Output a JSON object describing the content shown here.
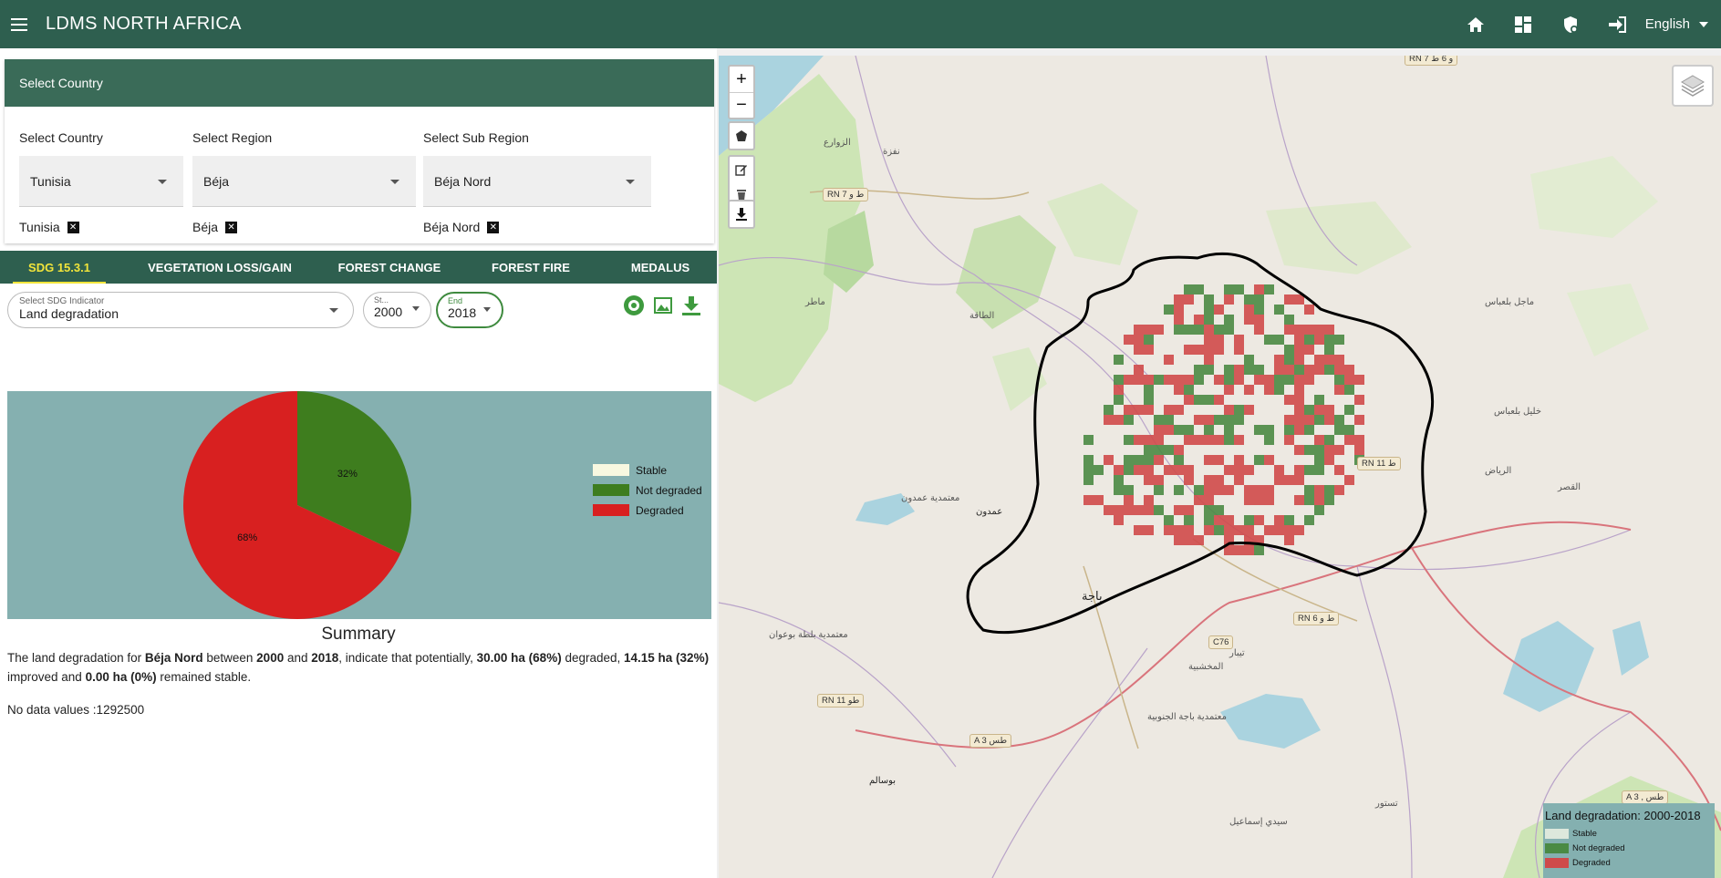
{
  "header": {
    "title": "LDMS NORTH AFRICA",
    "language": "English"
  },
  "country_card": {
    "title": "Select Country",
    "country_label": "Select Country",
    "region_label": "Select Region",
    "subregion_label": "Select Sub Region",
    "country_value": "Tunisia",
    "region_value": "Béja",
    "subregion_value": "Béja Nord",
    "chips": [
      "Tunisia",
      "Béja",
      "Béja Nord"
    ]
  },
  "tabs": [
    {
      "label": "SDG 15.3.1",
      "active": true
    },
    {
      "label": "VEGETATION LOSS/GAIN",
      "active": false
    },
    {
      "label": "FOREST CHANGE",
      "active": false
    },
    {
      "label": "FOREST FIRE",
      "active": false
    },
    {
      "label": "MEDALUS",
      "active": false
    }
  ],
  "controls": {
    "indicator_label": "Select SDG Indicator",
    "indicator_value": "Land degradation",
    "start_label": "St...",
    "start_value": "2000",
    "end_label": "End",
    "end_value": "2018"
  },
  "chart_data": {
    "type": "pie",
    "title": "",
    "categories": [
      "Stable",
      "Not degraded",
      "Degraded"
    ],
    "values": [
      0,
      32,
      68
    ],
    "labels": [
      "",
      "32%",
      "68%"
    ],
    "colors": [
      "#f8f8e0",
      "#3e7d1e",
      "#d82020"
    ],
    "legend": "right"
  },
  "summary": {
    "title": "Summary",
    "t1": "The land degradation for ",
    "region": "Béja Nord",
    "t2": " between ",
    "start": "2000",
    "t3": " and ",
    "end": "2018",
    "t4": ", indicate that potentially, ",
    "degraded": "30.00 ha (68%)",
    "t5": " degraded, ",
    "improved": "14.15 ha (32%)",
    "t6": " improved and ",
    "stable": "0.00 ha (0%)",
    "t7": " remained stable.",
    "nodata": "No data values :1292500"
  },
  "map": {
    "zoom_in": "+",
    "zoom_out": "−",
    "legend_title": "Land degradation: 2000-2018",
    "legend": [
      {
        "label": "Stable",
        "color": "#dde8dc"
      },
      {
        "label": "Not degraded",
        "color": "#4a8a44"
      },
      {
        "label": "Degraded",
        "color": "#cf4a4a"
      }
    ],
    "places": [
      "باجة",
      "عمدون",
      "معتمدية عمدون",
      "معتمدية باجة الجنوبية",
      "الطاقة",
      "الرياض",
      "ماجل بلعباس",
      "تستور",
      "نفزة",
      "معتمدية بلطة بوعوان",
      "الزوارع",
      "تيبار",
      "المخشبية",
      "سيدي إسماعيل",
      "القصر",
      "خليل بلعباس",
      "بوسالم",
      "ماطر"
    ],
    "roads": [
      "RN 7 ط و",
      "RN 11 ط",
      "RN 6 ط و",
      "RN 11 طو",
      "C76",
      "A 3 طس",
      "A 3 , طس",
      "RN 7 و 6 ط"
    ]
  }
}
